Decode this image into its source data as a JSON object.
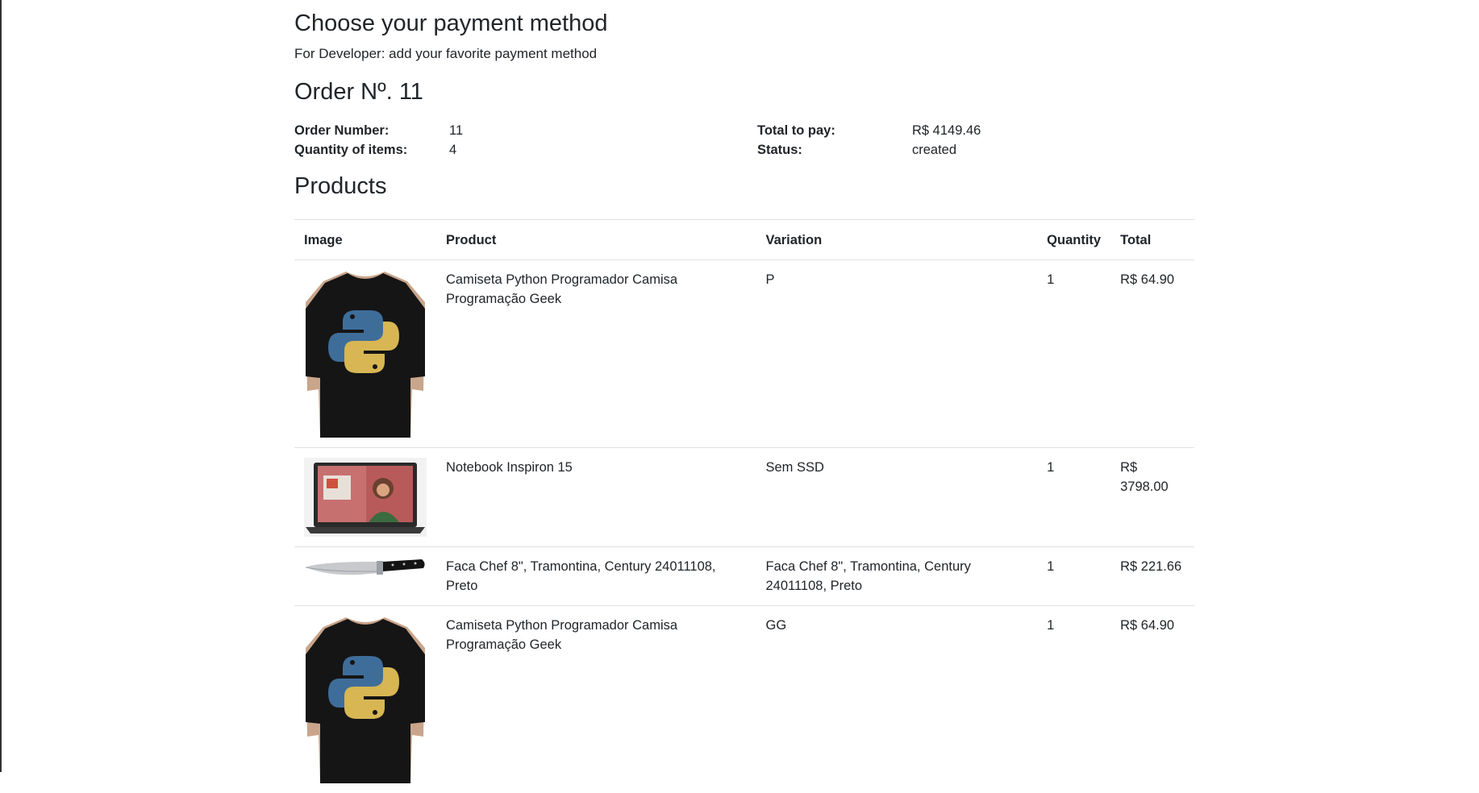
{
  "page": {
    "title": "Choose your payment method",
    "developer_note": "For Developer: add your favorite payment method"
  },
  "order": {
    "heading": "Order Nº. 11",
    "number_label": "Order Number:",
    "number_value": "11",
    "quantity_label": "Quantity of items:",
    "quantity_value": "4",
    "total_label": "Total to pay:",
    "total_value": "R$ 4149.46",
    "status_label": "Status:",
    "status_value": "created"
  },
  "products": {
    "heading": "Products",
    "columns": [
      "Image",
      "Product",
      "Variation",
      "Quantity",
      "Total"
    ],
    "rows": [
      {
        "image": "python-tshirt",
        "product": "Camiseta Python Programador Camisa Programação Geek",
        "variation": "P",
        "quantity": "1",
        "total": "R$ 64.90"
      },
      {
        "image": "laptop",
        "product": "Notebook Inspiron 15",
        "variation": "Sem SSD",
        "quantity": "1",
        "total": "R$ 3798.00"
      },
      {
        "image": "chef-knife",
        "product": "Faca Chef 8\", Tramontina, Century 24011108, Preto",
        "variation": "Faca Chef 8\", Tramontina, Century 24011108, Preto",
        "quantity": "1",
        "total": "R$ 221.66"
      },
      {
        "image": "python-tshirt",
        "product": "Camiseta Python Programador Camisa Programação Geek",
        "variation": "GG",
        "quantity": "1",
        "total": "R$ 64.90"
      }
    ]
  }
}
